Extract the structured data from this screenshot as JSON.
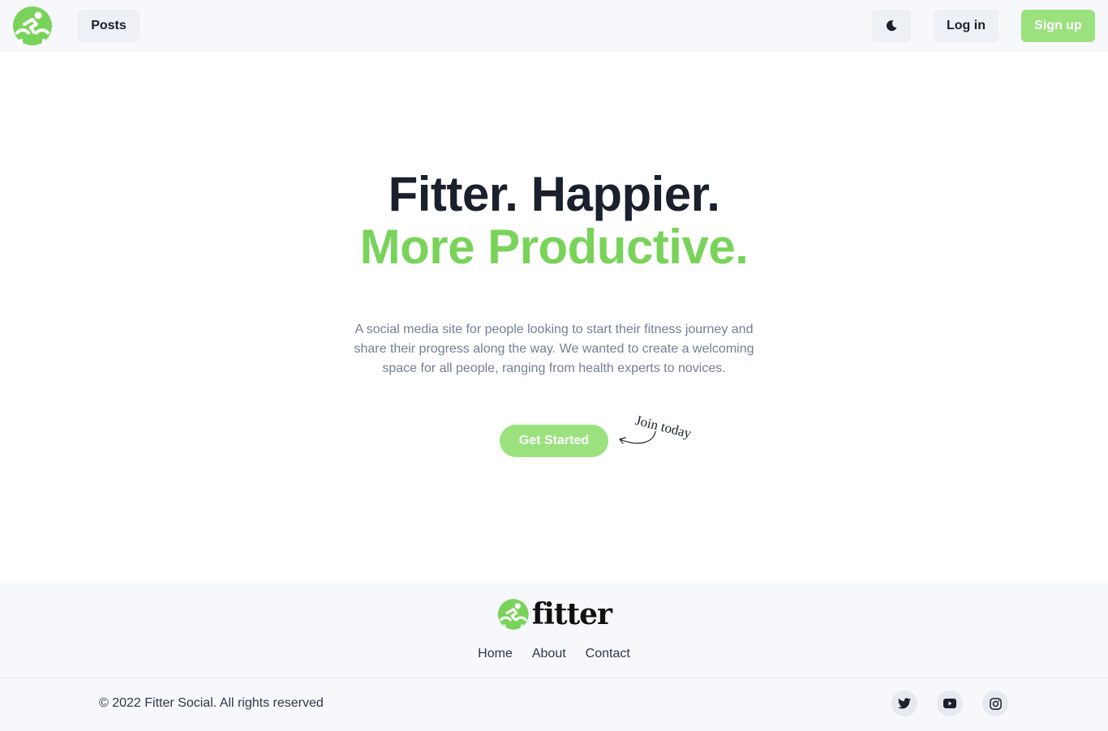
{
  "nav": {
    "logo_icon": "cyclist-logo-icon",
    "posts_label": "Posts",
    "theme_icon": "moon-icon",
    "login_label": "Log in",
    "signup_label": "Sign up"
  },
  "hero": {
    "line1": "Fitter. Happier.",
    "line2": "More Productive.",
    "description": "A social media site for people looking to start their fitness journey and share their progress along the way. We wanted to create a welcoming space for all people, ranging from health experts to novices.",
    "cta_label": "Get Started",
    "annotation": "Join today"
  },
  "footer": {
    "logo_text": "fitter",
    "links": [
      "Home",
      "About",
      "Contact"
    ],
    "copyright": "© 2022 Fitter Social. All rights reserved",
    "social_icons": [
      "twitter-icon",
      "youtube-icon",
      "instagram-icon"
    ]
  },
  "colors": {
    "brand_green": "#79d35a",
    "button_green": "#9be27f",
    "dark_text": "#1a202c",
    "muted_text": "#718096"
  }
}
